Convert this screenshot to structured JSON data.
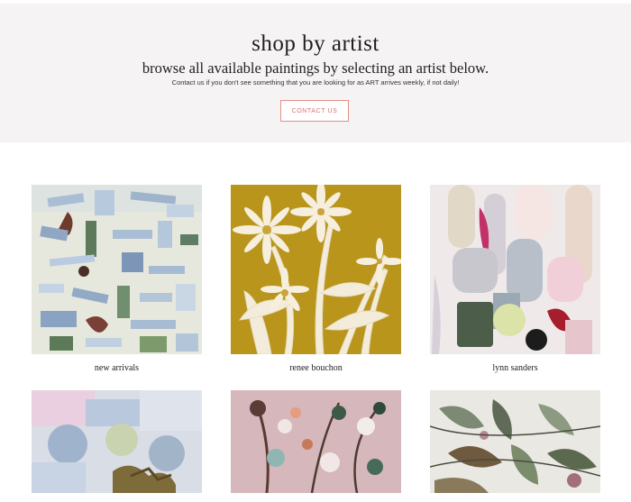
{
  "hero": {
    "title": "shop by artist",
    "subtitle": "browse all available paintings by selecting an artist below.",
    "note": "Contact us if you don't see something that you are looking for as ART arrives weekly, if not daily!",
    "contact_button": "CONTACT US"
  },
  "artists": [
    {
      "label": "new arrivals"
    },
    {
      "label": "renee bouchon"
    },
    {
      "label": "lynn sanders"
    },
    {
      "label": ""
    },
    {
      "label": ""
    },
    {
      "label": ""
    }
  ],
  "colors": {
    "hero_bg": "#f6f3f5",
    "button_border": "#e28f8a",
    "button_text": "#d9736c",
    "mustard": "#b9951c"
  }
}
